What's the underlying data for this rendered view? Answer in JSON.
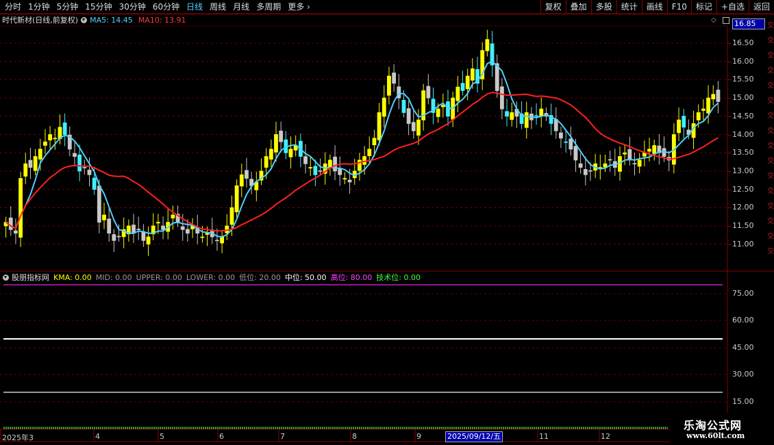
{
  "toolbar": {
    "periods": [
      "分时",
      "1分钟",
      "5分钟",
      "15分钟",
      "30分钟",
      "60分钟",
      "日线",
      "周线",
      "月线",
      "多周期",
      "更多"
    ],
    "active_period": "日线",
    "right_buttons": [
      "复权",
      "叠加",
      "多股",
      "统计",
      "画线",
      "F10",
      "标记",
      "+自选",
      "返回"
    ]
  },
  "main": {
    "stock_name": "时代新材(日线,前复权)",
    "ma5_label": "MA5: 14.45",
    "ma10_label": "MA10: 13.91",
    "price_tag": "16.85",
    "price_axis": [
      "16.50",
      "16.00",
      "15.50",
      "15.00",
      "14.50",
      "14.00",
      "13.50",
      "13.00",
      "12.50",
      "12.00",
      "11.50",
      "11.00"
    ]
  },
  "indicator": {
    "name": "股朋指标网",
    "kma": "KMA: 0.00",
    "mid": "MID: 0.00",
    "upper": "UPPER: 0.00",
    "lower": "LOWER: 0.00",
    "low": "低位: 20.00",
    "middle": "中位: 50.00",
    "high": "高位: 80.00",
    "tech": "技术位: 0.00",
    "axis": [
      "75.00",
      "60.00",
      "45.00",
      "30.00",
      "15.00"
    ]
  },
  "dates": {
    "labels": [
      "2025年3",
      "4",
      "5",
      "6",
      "7",
      "8",
      "9",
      "11",
      "12"
    ],
    "cursor": "2025/09/12/五"
  },
  "watermark": {
    "line1": "乐淘公式网",
    "line2": "www.60lt.com"
  },
  "colors": {
    "up_yellow": "#ffff00",
    "down_cyan": "#3ff0ff",
    "down_gray": "#c8c8c8",
    "ma5": "#4fd0ff",
    "ma10": "#ff2020",
    "grid": "#8b0000"
  }
}
